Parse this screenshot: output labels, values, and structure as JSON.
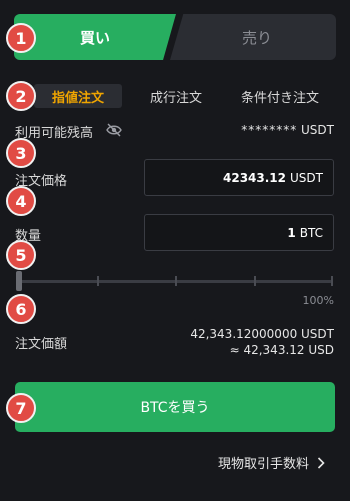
{
  "tabs": {
    "buy": "買い",
    "sell": "売り"
  },
  "order_types": {
    "limit": "指値注文",
    "market": "成行注文",
    "conditional": "条件付き注文"
  },
  "available": {
    "label": "利用可能残高",
    "value": "********",
    "unit": "USDT"
  },
  "price": {
    "label": "注文価格",
    "value": "42343.12",
    "unit": "USDT"
  },
  "quantity": {
    "label": "数量",
    "value": "1",
    "unit": "BTC"
  },
  "slider": {
    "max_label": "100%",
    "level": 0
  },
  "order_value": {
    "label": "注文価額",
    "usdt": "42,343.12000000 USDT",
    "usd": "≈ 42,343.12 USD"
  },
  "buy_button": "BTCを買う",
  "fee_link": "現物取引手数料",
  "badges": [
    "1",
    "2",
    "3",
    "4",
    "5",
    "6",
    "7"
  ],
  "colors": {
    "buy": "#27ae60",
    "accent": "#f0a500",
    "badge": "#e14b44",
    "bg": "#17181c"
  }
}
